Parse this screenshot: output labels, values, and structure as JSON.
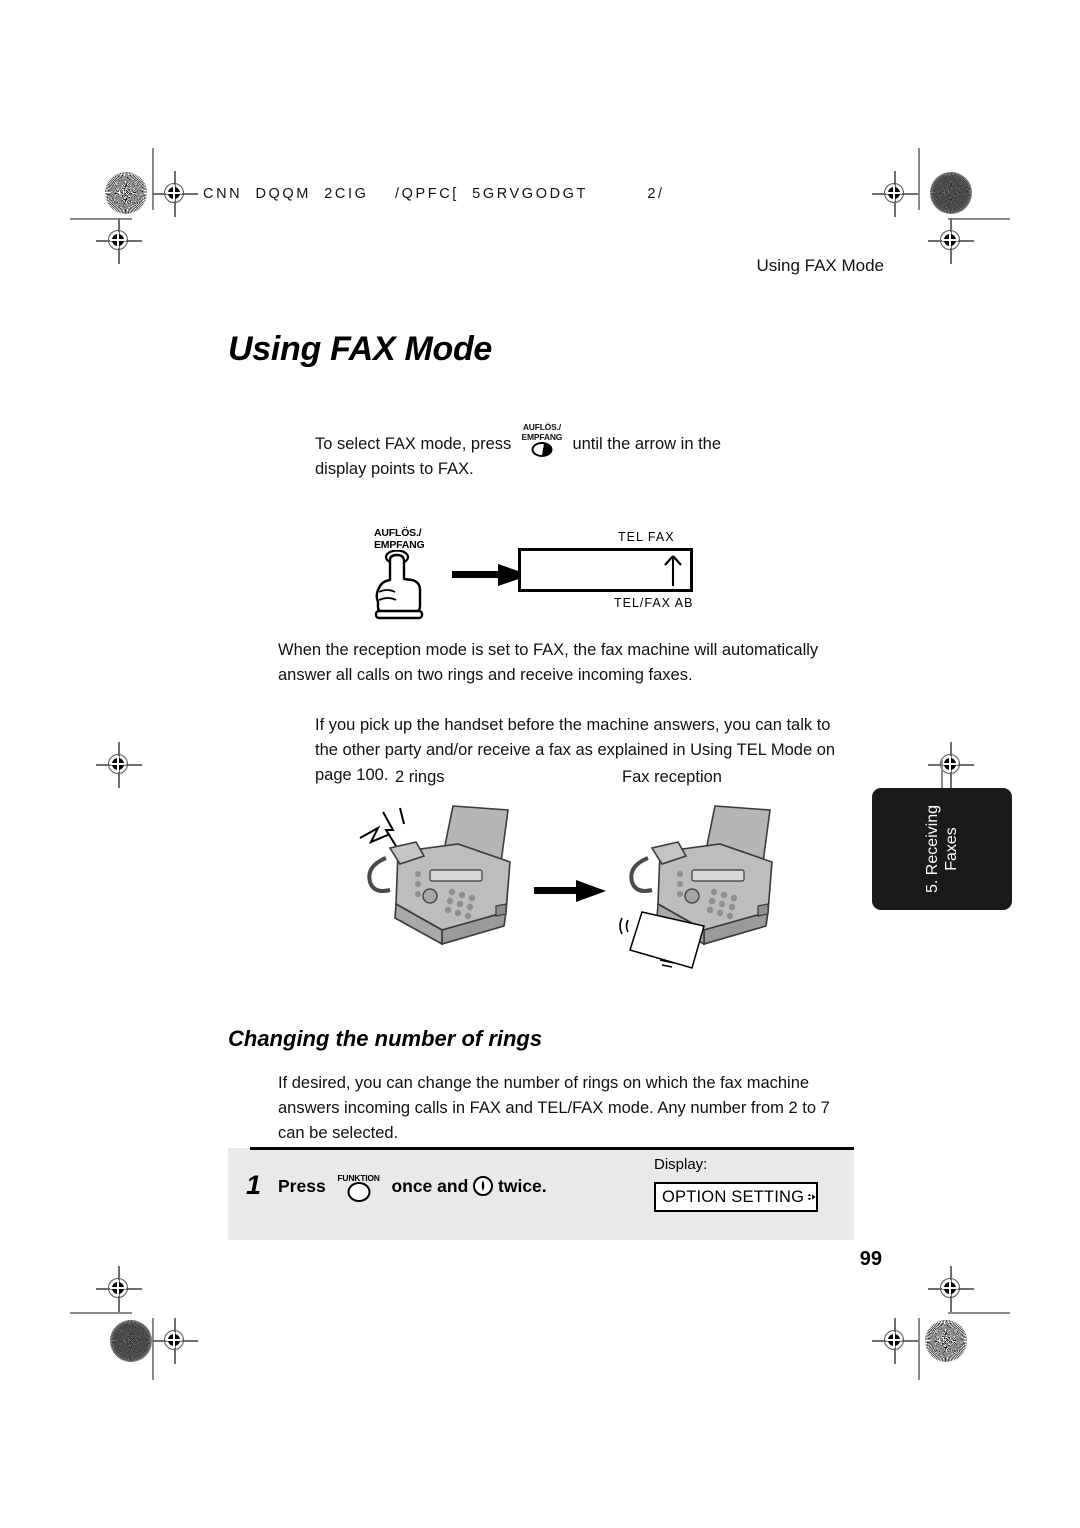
{
  "prepress": {
    "slugline": "CNN  DQQM  2CIG    /QPFC[  5GRVGODGT         2/",
    "color_patch_name": "starburst-resolution-target",
    "reg_mark_name": "registration-crosshair"
  },
  "header": {
    "running_head": "Using FAX Mode"
  },
  "titles": {
    "page_title": "Using FAX Mode",
    "sub_title": "Changing the number of rings"
  },
  "intro": {
    "before_key": "To select FAX mode, press",
    "key_label_line1": "AUFLÖS./",
    "key_label_line2": "EMPFANG",
    "after_key": "until the arrow in the display points to FAX."
  },
  "press_diagram": {
    "key_label_line1": "AUFLÖS./",
    "key_label_line2": "EMPFANG",
    "hand_icon": "pointing-hand-icon",
    "arrow_icon": "right-arrow-icon",
    "lcd_top": "TEL  FAX",
    "lcd_bottom": "TEL/FAX  AB",
    "lcd_pointer": "up-arrow-icon"
  },
  "paragraphs": {
    "p1": "When the reception mode is set to FAX, the fax machine will automatically answer all calls on two rings and receive incoming faxes.",
    "p2": "If you pick up the handset before the machine answers, you can talk to the other party and/or receive a fax as explained in Using TEL Mode on page 100.",
    "p3": "If desired, you can change the number of rings on which the fax machine answers incoming calls in FAX and TEL/FAX mode. Any number from 2 to 7 can be selected."
  },
  "illustration": {
    "caption_left": "2 rings",
    "caption_right": "Fax reception",
    "machine_left_icon": "fax-machine-ringing-illustration",
    "machine_right_icon": "fax-machine-printing-illustration",
    "arrow_icon": "right-arrow-icon"
  },
  "side_tab": {
    "line1": "5. Receiving",
    "line2": "Faxes"
  },
  "step": {
    "number": "1",
    "text_before": "Press",
    "key1_label": "FUNKTION",
    "text_middle": "once and",
    "key2_icon": "down-arrow-key-icon",
    "text_after": "twice.",
    "display_label": "Display:",
    "display_value": "OPTION SETTING",
    "display_arrows": "up-down-right-arrows-icon"
  },
  "footer": {
    "page_number": "99"
  },
  "colors": {
    "paper": "#ffffff",
    "ink": "#000000",
    "step_box": "#e9e9e9",
    "tab": "#1a1a1a",
    "machine_body": "#b5b5b5",
    "machine_shade": "#9a9a9a"
  }
}
